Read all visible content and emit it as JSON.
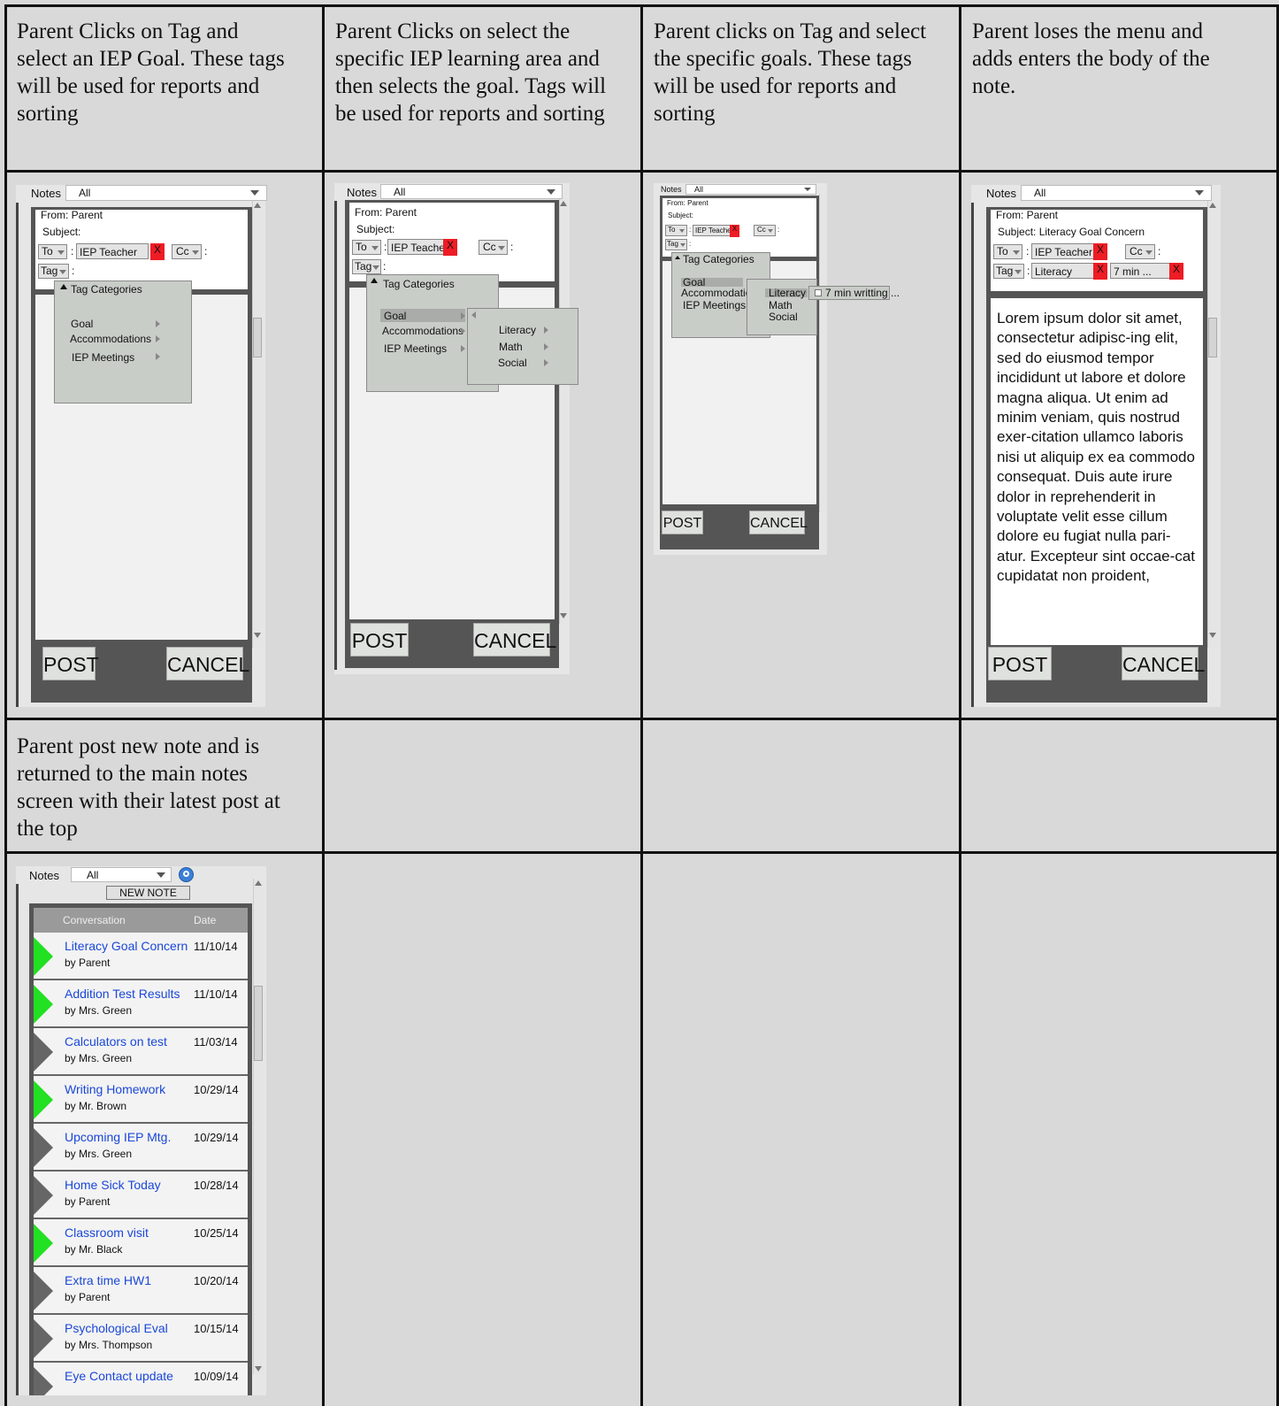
{
  "captions": [
    "Parent Clicks on Tag and\nselect an IEP Goal. These tags\nwill be used for reports and\nsorting",
    "Parent Clicks on select the\nspecific IEP learning area and\nthen selects the goal. Tags will\nbe used for reports and sorting",
    "Parent clicks on Tag and select\nthe specific goals. These tags\nwill be used for reports and\nsorting",
    "Parent loses the menu and\nadds enters the body of the\nnote.",
    "Parent post new note and is\nreturned to the main notes\nscreen with their latest post at\nthe top"
  ],
  "common": {
    "notes_label": "Notes",
    "filter_value": "All",
    "from": "From: Parent",
    "subject_empty": "Subject:",
    "to_label": "To",
    "recipient": "IEP Teacher",
    "x_label": "X",
    "cc_label": "Cc",
    "colon": ":",
    "tag_label": "Tag",
    "post": "POST",
    "cancel": "CANCEL",
    "tag_categories": "Tag Categories",
    "categories": [
      "Goal",
      "Accommodations",
      "IEP Meetings"
    ],
    "areas": [
      "Literacy",
      "Math",
      "Social"
    ],
    "goal_option": "7 min writting ..."
  },
  "screen4": {
    "subject": "Subject: Literacy Goal Concern",
    "tag_literacy": "Literacy",
    "tag_goal": "7 min ...",
    "body": "Lorem ipsum dolor sit amet, consectetur adipisc-ing elit, sed do eiusmod tempor incididunt ut labore et dolore magna aliqua. Ut enim ad minim veniam, quis nostrud exer-citation ullamco laboris nisi ut aliquip ex ea commodo consequat. Duis aute irure dolor in reprehenderit in voluptate velit esse cillum dolore eu fugiat nulla pari-atur. Excepteur sint occae-cat cupidatat non proident,"
  },
  "screen5": {
    "new_note": "NEW NOTE",
    "col_conversation": "Conversation",
    "col_date": "Date",
    "search_icon": "magnifier-icon",
    "rows": [
      {
        "title": "Literacy Goal Concern",
        "by": "by Parent",
        "date": "11/10/14",
        "status": "new"
      },
      {
        "title": "Addition Test Results",
        "by": "by Mrs. Green",
        "date": "11/10/14",
        "status": "new"
      },
      {
        "title": "Calculators on test",
        "by": "by Mrs. Green",
        "date": "11/03/14",
        "status": "read"
      },
      {
        "title": "Writing Homework",
        "by": "by Mr. Brown",
        "date": "10/29/14",
        "status": "new"
      },
      {
        "title": "Upcoming IEP Mtg.",
        "by": "by Mrs.  Green",
        "date": "10/29/14",
        "status": "read"
      },
      {
        "title": "Home Sick Today",
        "by": "by Parent",
        "date": "10/28/14",
        "status": "read"
      },
      {
        "title": "Classroom visit",
        "by": "by Mr. Black",
        "date": "10/25/14",
        "status": "new"
      },
      {
        "title": "Extra time HW1",
        "by": "by Parent",
        "date": "10/20/14",
        "status": "read"
      },
      {
        "title": "Psychological Eval",
        "by": "by Mrs. Thompson",
        "date": "10/15/14",
        "status": "read"
      },
      {
        "title": "Eye Contact update",
        "by": "",
        "date": "10/09/14",
        "status": "read"
      }
    ]
  },
  "colors": {
    "new_marker": "#22e022",
    "read_marker": "#666666",
    "link": "#1a47d8",
    "delete": "#ee1c24"
  }
}
